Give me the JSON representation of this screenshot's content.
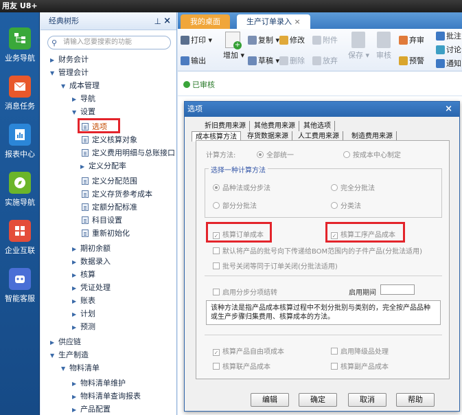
{
  "window": {
    "title": "用友 U8+"
  },
  "leftnav": [
    {
      "label": "业务导航",
      "icon": "tree-icon",
      "color": "#3aa83a"
    },
    {
      "label": "消息任务",
      "icon": "envelope-icon",
      "color": "#e8582b"
    },
    {
      "label": "报表中心",
      "icon": "report-icon",
      "color": "#2b86d8"
    },
    {
      "label": "实施导航",
      "icon": "compass-icon",
      "color": "#6bb52a"
    },
    {
      "label": "企业互联",
      "icon": "link-icon",
      "color": "#e44d3a"
    },
    {
      "label": "智能客服",
      "icon": "robot-icon",
      "color": "#4a6fd6"
    }
  ],
  "tree": {
    "title": "经典树形",
    "search_placeholder": "请输入您要搜索的功能",
    "nodes": [
      {
        "label": "财务会计",
        "arrow": "▶"
      },
      {
        "label": "管理会计",
        "arrow": "▼"
      },
      {
        "label": "成本管理",
        "arrow": "▼"
      },
      {
        "label": "导航",
        "arrow": "▶"
      },
      {
        "label": "设置",
        "arrow": "▼"
      },
      {
        "label": "选项"
      },
      {
        "label": "定义核算对象"
      },
      {
        "label": "定义费用明细与总账接口"
      },
      {
        "label": "定义分配率",
        "arrow": "▶"
      },
      {
        "label": "定义分配范围"
      },
      {
        "label": "定义存货参考成本"
      },
      {
        "label": "定额分配标准"
      },
      {
        "label": "科目设置"
      },
      {
        "label": "重新初始化"
      },
      {
        "label": "期初余额",
        "arrow": "▶"
      },
      {
        "label": "数据录入",
        "arrow": "▶"
      },
      {
        "label": "核算",
        "arrow": "▶"
      },
      {
        "label": "凭证处理",
        "arrow": "▶"
      },
      {
        "label": "账表",
        "arrow": "▶"
      },
      {
        "label": "计划",
        "arrow": "▶"
      },
      {
        "label": "预测",
        "arrow": "▶"
      },
      {
        "label": "供应链",
        "arrow": "▶"
      },
      {
        "label": "生产制造",
        "arrow": "▼"
      },
      {
        "label": "物料清单",
        "arrow": "▼"
      },
      {
        "label": "物料清单维护",
        "arrow": "▶"
      },
      {
        "label": "物料清单查询报表",
        "arrow": "▶"
      },
      {
        "label": "产品配置",
        "arrow": "▶"
      }
    ]
  },
  "tabs": {
    "desktop": "我的桌面",
    "order": "生产订单录入",
    "close": "×"
  },
  "toolbar": {
    "print": "打印",
    "output": "输出",
    "add": "增加",
    "copy": "复制",
    "draft": "草稿",
    "modify": "修改",
    "delete": "删除",
    "attach": "附件",
    "abandon": "放弃",
    "save": "保存",
    "audit": "审核",
    "discard": "弃审",
    "alert": "预警",
    "approve": "批注",
    "discuss": "讨论",
    "notify": "通知"
  },
  "status": {
    "text": "已审核"
  },
  "dialog": {
    "title": "选项",
    "tabs_row1": [
      "折旧费用来源",
      "其他费用来源",
      "其他选项"
    ],
    "tabs_row2": [
      "成本核算方法",
      "存货数据来源",
      "人工费用来源",
      "制造费用来源"
    ],
    "calc_method_label": "计算方法:",
    "calc_unified": "全部统一",
    "calc_by_center": "按成本中心制定",
    "choose_method": "选择一种计算方法",
    "m1": "品种法或分步法",
    "m2": "完全分批法",
    "m3": "部分分批法",
    "m4": "分类法",
    "cb_order": "核算订单成本",
    "cb_process": "核算工序产品成本",
    "cb_bom": "默认将产品的批号向下传递给BOM范围内的子件产品(分批法适用)",
    "cb_close": "批号关闭等同于订单关闭(分批法适用)",
    "cb_step": "启用分步分项结转",
    "enable_period_label": "启用期间",
    "desc": "该种方法是指产品成本核算过程中不划分批别与类别的，完全按产品品种或生产步骤归集费用、核算成本的方法。",
    "cb_self": "核算产品自由项成本",
    "cb_downgrade": "启用降级品处理",
    "cb_joint": "核算联产品成本",
    "cb_by": "核算副产品成本",
    "buttons": {
      "edit": "编辑",
      "ok": "确定",
      "cancel": "取消",
      "help": "帮助"
    }
  }
}
